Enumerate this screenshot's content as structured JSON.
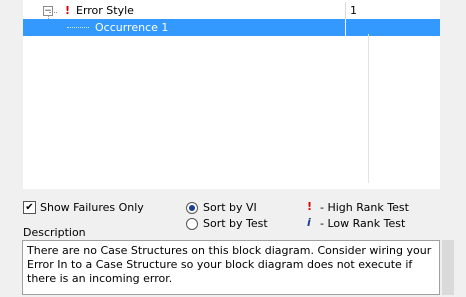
{
  "tree": {
    "rows": [
      {
        "label": "Error Style",
        "count": "1",
        "rank_mark": "!"
      },
      {
        "label": "Occurrence 1",
        "count": ""
      }
    ],
    "expander": "−"
  },
  "options": {
    "show_failures_only": {
      "label": "Show Failures Only",
      "checked": true
    },
    "sort_by_vi": {
      "label": "Sort by VI",
      "selected": true
    },
    "sort_by_test": {
      "label": "Sort by Test",
      "selected": false
    }
  },
  "legend": {
    "high": {
      "icon": "!",
      "label": "- High Rank Test",
      "color": "#d40000"
    },
    "low": {
      "icon": "i",
      "label": "- Low Rank Test",
      "color": "#1a3d8f"
    }
  },
  "description": {
    "title": "Description",
    "text": "There are no Case Structures on this block diagram.  Consider wiring your Error In to a Case Structure so your block diagram does not execute if there is an incoming error."
  },
  "colors": {
    "selection": "#3399ff",
    "accent": "#d40000"
  }
}
